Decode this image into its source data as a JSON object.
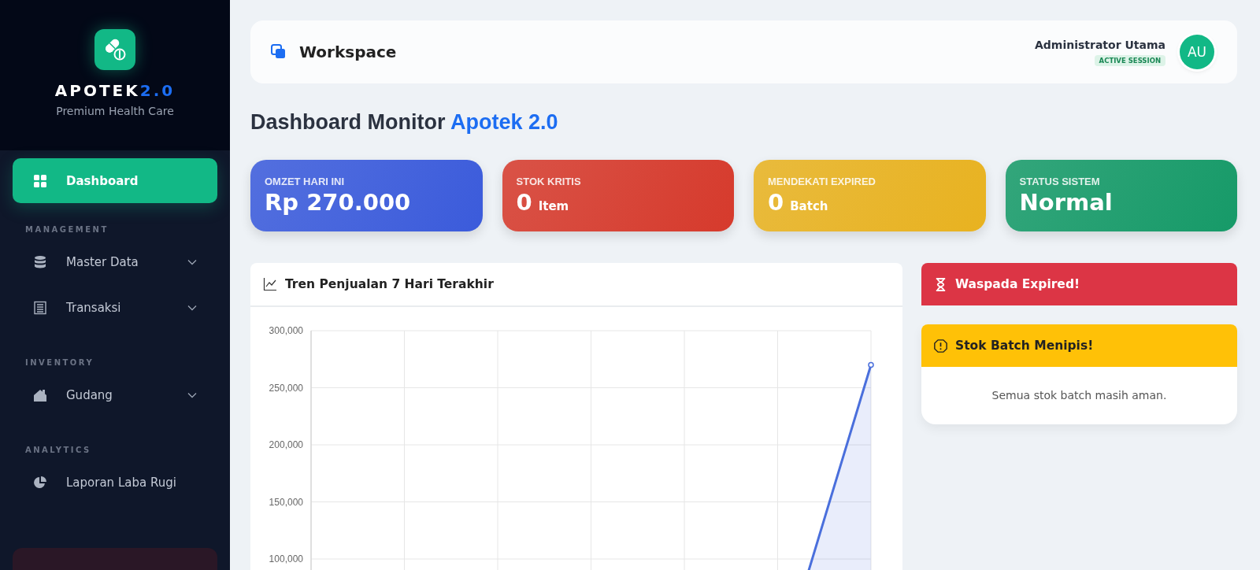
{
  "sidebar": {
    "brand": {
      "name": "APOTEK",
      "version": "2.0",
      "tagline": "Premium Health Care"
    },
    "sections": [
      {
        "items": [
          {
            "label": "Dashboard",
            "selected": true,
            "expandable": false
          }
        ]
      },
      {
        "title": "MANAGEMENT",
        "items": [
          {
            "label": "Master Data",
            "selected": false,
            "expandable": true
          },
          {
            "label": "Transaksi",
            "selected": false,
            "expandable": true
          }
        ]
      },
      {
        "title": "INVENTORY",
        "items": [
          {
            "label": "Gudang",
            "selected": false,
            "expandable": true
          }
        ]
      },
      {
        "title": "ANALYTICS",
        "items": [
          {
            "label": "Laporan Laba Rugi",
            "selected": false,
            "expandable": false
          }
        ]
      }
    ]
  },
  "header": {
    "title": "Workspace",
    "user": {
      "name": "Administrator Utama",
      "status": "ACTIVE SESSION",
      "initials": "AU"
    }
  },
  "page_title": {
    "text": "Dashboard Monitor",
    "highlight": "Apotek 2.0"
  },
  "stats": [
    {
      "label": "OMZET HARI INI",
      "value": "Rp 270.000",
      "color": "#3b5bdb"
    },
    {
      "label": "STOK KRITIS",
      "value": "0",
      "unit": "Item",
      "color": "#d63a2c"
    },
    {
      "label": "MENDEKATI EXPIRED",
      "value": "0",
      "unit": "Batch",
      "color": "#e8b220"
    },
    {
      "label": "STATUS SISTEM",
      "value": "Normal",
      "color": "#169a68"
    }
  ],
  "sales_chart": {
    "title": "Tren Penjualan 7 Hari Terakhir",
    "chart_data": {
      "type": "area",
      "series": [
        {
          "color": "#4a6fdc",
          "values": [
            0,
            0,
            0,
            0,
            0,
            0,
            270000
          ]
        }
      ],
      "grid": true,
      "ylim": [
        0,
        300000
      ],
      "yticks": [
        {
          "value": 100000,
          "label": "100,000"
        },
        {
          "value": 150000,
          "label": "150,000"
        },
        {
          "value": 200000,
          "label": "200,000"
        },
        {
          "value": 250000,
          "label": "250,000"
        },
        {
          "value": 300000,
          "label": "300,000"
        }
      ]
    }
  },
  "alerts": [
    {
      "kind": "danger",
      "title": "Waspada Expired!"
    },
    {
      "kind": "warning",
      "title": "Stok Batch Menipis!",
      "message": "Semua stok batch masih aman."
    }
  ]
}
